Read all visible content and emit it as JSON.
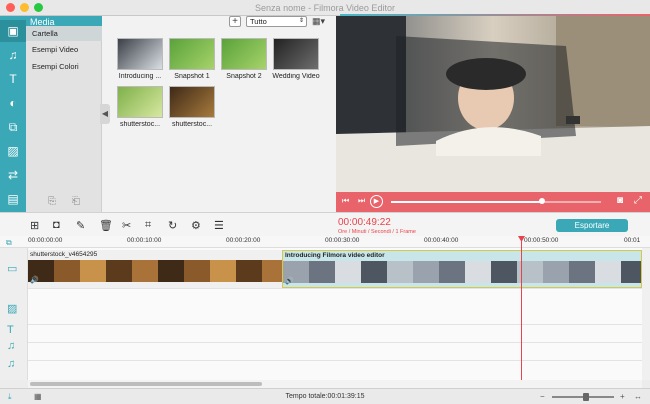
{
  "window": {
    "title": "Senza nome - Filmora Video Editor",
    "lights": [
      "#ff5f57",
      "#febc2e",
      "#28c840"
    ]
  },
  "sidebar": {
    "items": [
      {
        "name": "media",
        "icon": "film-icon",
        "glyph": "▣"
      },
      {
        "name": "music",
        "icon": "music-note-icon",
        "glyph": "♫"
      },
      {
        "name": "text",
        "icon": "text-icon",
        "glyph": "T"
      },
      {
        "name": "filters",
        "icon": "filter-icon",
        "glyph": "◐"
      },
      {
        "name": "overlays",
        "icon": "overlay-icon",
        "glyph": "⧉"
      },
      {
        "name": "elements",
        "icon": "image-icon",
        "glyph": "▨"
      },
      {
        "name": "transitions",
        "icon": "transition-icon",
        "glyph": "⇄"
      },
      {
        "name": "split-screen",
        "icon": "split-screen-icon",
        "glyph": "▤"
      }
    ]
  },
  "media_panel": {
    "header": "Media",
    "categories": [
      "Cartella",
      "Esempi Video",
      "Esempi Colori"
    ],
    "selected_category": "Cartella",
    "add_label": "+",
    "filter_value": "Tutto",
    "thumbnails": [
      {
        "label": "Introducing ...",
        "colors": [
          "#3b3f47",
          "#d9dfe4"
        ]
      },
      {
        "label": "Snapshot 1",
        "colors": [
          "#5aa23a",
          "#a6d36a"
        ]
      },
      {
        "label": "Snapshot 2",
        "colors": [
          "#5aa23a",
          "#a6d36a"
        ]
      },
      {
        "label": "Wedding Video",
        "colors": [
          "#222222",
          "#6e6e6e"
        ]
      },
      {
        "label": "shutterstoc...",
        "colors": [
          "#7fb04a",
          "#d7e8a0"
        ]
      },
      {
        "label": "shutterstoc...",
        "colors": [
          "#3f2a18",
          "#a77a3c"
        ]
      }
    ]
  },
  "toolbar": {
    "timecode": "00:00:49:22",
    "timecode_sub": "Ore / Minuti / Secondi / 1 Frame",
    "export_label": "Esportare",
    "tools": [
      {
        "name": "record-icon",
        "glyph": "⊞"
      },
      {
        "name": "snapshot-icon",
        "glyph": "◘"
      },
      {
        "name": "microphone-icon",
        "glyph": "✎"
      },
      {
        "name": "delete-icon",
        "glyph": "🗑"
      },
      {
        "name": "cut-icon",
        "glyph": "✂"
      },
      {
        "name": "crop-icon",
        "glyph": "⌗"
      },
      {
        "name": "rotate-icon",
        "glyph": "↻"
      },
      {
        "name": "settings-icon",
        "glyph": "⚙"
      },
      {
        "name": "adjust-icon",
        "glyph": "☰"
      }
    ]
  },
  "timeline": {
    "ruler": [
      "00:00:00:00",
      "00:00:10:00",
      "00:00:20:00",
      "00:00:30:00",
      "00:00:40:00",
      "00:00:50:00",
      "00:01"
    ],
    "clip1_name": "shutterstock_v4654295",
    "clip2_name": "Introducing Filmora video editor",
    "playhead_progress": 0.8
  },
  "playback": {
    "rewind_label": "⏮",
    "play_label": "▶",
    "forward_label": "⏭",
    "progress": 0.72
  },
  "bottom": {
    "total_time": "Tempo totale:00:01:39:15",
    "zoom_level": 0.55
  },
  "colors": {
    "accent": "#3aa8b6",
    "preview_bar": "#e8646a",
    "playhead": "#e8434a"
  }
}
